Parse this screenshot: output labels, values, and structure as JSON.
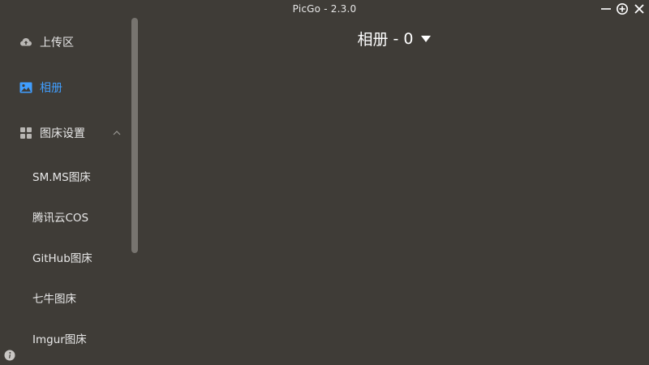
{
  "window": {
    "title": "PicGo - 2.3.0"
  },
  "sidebar": {
    "items": [
      {
        "label": "上传区",
        "icon": "cloud-upload-icon",
        "active": false
      },
      {
        "label": "相册",
        "icon": "image-icon",
        "active": true
      },
      {
        "label": "图床设置",
        "icon": "grid-icon",
        "active": false,
        "expanded": true
      }
    ],
    "sub_items": [
      {
        "label": "SM.MS图床"
      },
      {
        "label": "腾讯云COS"
      },
      {
        "label": "GitHub图床"
      },
      {
        "label": "七牛图床"
      },
      {
        "label": "Imgur图床"
      }
    ]
  },
  "main": {
    "album_title": "相册",
    "separator": "-",
    "count": "0"
  },
  "colors": {
    "background": "#3f3c37",
    "accent": "#409eff",
    "text": "#e8e8e8",
    "scrollbar": "#77746f"
  }
}
